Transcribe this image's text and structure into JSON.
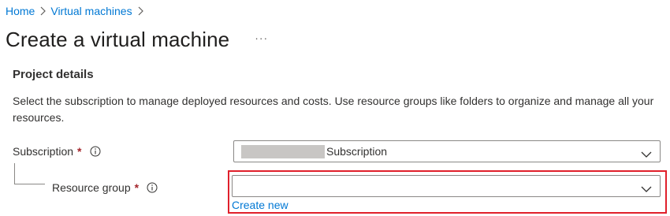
{
  "breadcrumb": {
    "items": [
      {
        "label": "Home"
      },
      {
        "label": "Virtual machines"
      }
    ],
    "separator": ">"
  },
  "page": {
    "title": "Create a virtual machine",
    "more_label": "···"
  },
  "section": {
    "title": "Project details",
    "description": "Select the subscription to manage deployed resources and costs. Use resource groups like folders to organize and manage all your resources."
  },
  "form": {
    "subscription": {
      "label": "Subscription",
      "required_mark": "*",
      "value": "Subscription",
      "value_redacted_prefix": true
    },
    "resource_group": {
      "label": "Resource group",
      "required_mark": "*",
      "value": "",
      "create_new_label": "Create new"
    }
  },
  "icons": {
    "info": "info-icon",
    "chevron": "chevron-down-icon",
    "breadcrumb_separator": "chevron-right-icon"
  },
  "colors": {
    "link": "#0078d4",
    "required": "#a4262c",
    "highlight": "#e0202b",
    "border": "#8a8886",
    "text": "#323130"
  }
}
